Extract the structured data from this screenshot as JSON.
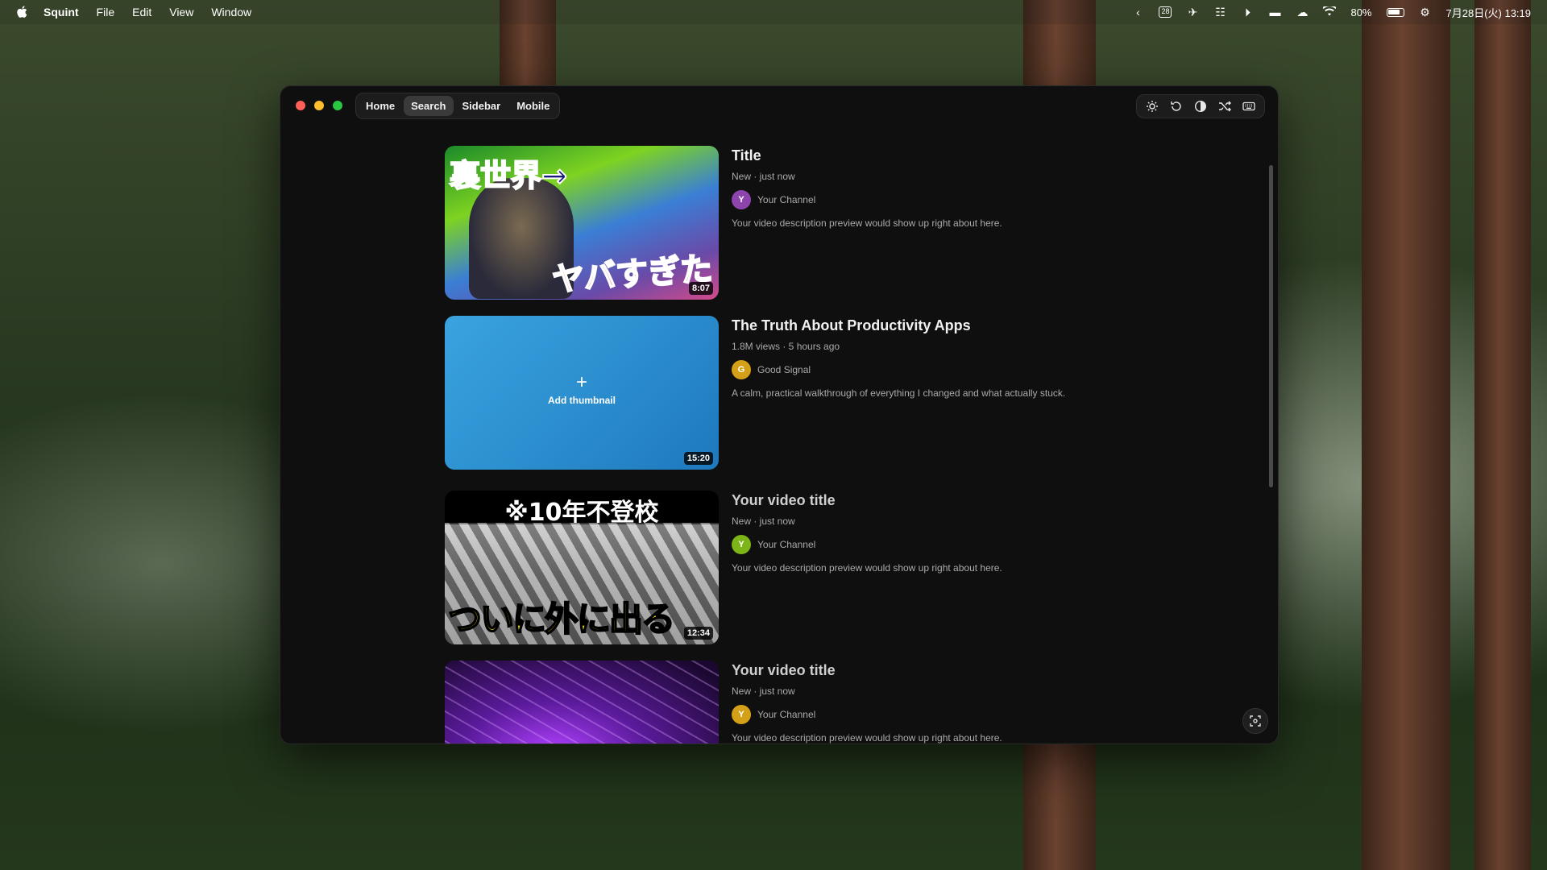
{
  "menubar": {
    "app_name": "Squint",
    "menus": [
      "File",
      "Edit",
      "View",
      "Window"
    ],
    "calendar_day": "28",
    "battery": "80%",
    "datetime": "7月28日(火)  13:19"
  },
  "window": {
    "nav": [
      {
        "label": "Home",
        "active": false
      },
      {
        "label": "Search",
        "active": true
      },
      {
        "label": "Sidebar",
        "active": false
      },
      {
        "label": "Mobile",
        "active": false
      }
    ],
    "tools": [
      "sun-icon",
      "rotate-icon",
      "contrast-icon",
      "shuffle-icon",
      "keyboard-icon"
    ]
  },
  "videos": [
    {
      "title": "Title",
      "stats": "New · just now",
      "channel": "Your Channel",
      "avatar_letter": "Y",
      "avatar_color": "#8e44ad",
      "description": "Your video description preview would show up right about here.",
      "duration": "8:07",
      "thumb_text_top": "裏世界→",
      "thumb_text_bottom": "ヤバすぎた"
    },
    {
      "title": "The Truth About Productivity Apps",
      "stats": "1.8M views · 5 hours ago",
      "channel": "Good Signal",
      "avatar_letter": "G",
      "avatar_color": "#d4a017",
      "description": "A calm, practical walkthrough of everything I changed and what actually stuck.",
      "duration": "15:20",
      "add_thumbnail": "Add thumbnail"
    },
    {
      "title": "Your video title",
      "stats": "New · just now",
      "channel": "Your Channel",
      "avatar_letter": "Y",
      "avatar_color": "#7cb518",
      "description": "Your video description preview would show up right about here.",
      "duration": "12:34",
      "thumb_text_top": "※10年不登校",
      "thumb_text_bottom": "ついに外に出る"
    },
    {
      "title": "Your video title",
      "stats": "New · just now",
      "channel": "Your Channel",
      "avatar_letter": "Y",
      "avatar_color": "#d4a017",
      "description": "Your video description preview would show up right about here."
    }
  ]
}
